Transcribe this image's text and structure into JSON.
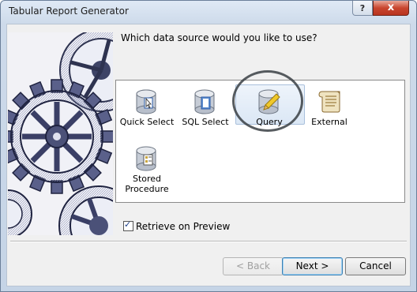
{
  "window": {
    "title": "Tabular Report Generator",
    "help_label": "?",
    "close_label": "x"
  },
  "prompt": "Which data source would you like to use?",
  "sources": [
    {
      "label": "Quick Select",
      "icon": "quick-select-database-icon"
    },
    {
      "label": "SQL Select",
      "icon": "sql-select-database-icon"
    },
    {
      "label": "Query",
      "icon": "query-database-icon",
      "selected": true
    },
    {
      "label": "External",
      "icon": "external-scroll-icon"
    },
    {
      "label": "Stored Procedure",
      "icon": "stored-procedure-database-icon"
    }
  ],
  "retrieve_on_preview": {
    "label": "Retrieve on Preview",
    "checked": true
  },
  "buttons": {
    "back": "< Back",
    "next": "Next >",
    "cancel": "Cancel"
  }
}
